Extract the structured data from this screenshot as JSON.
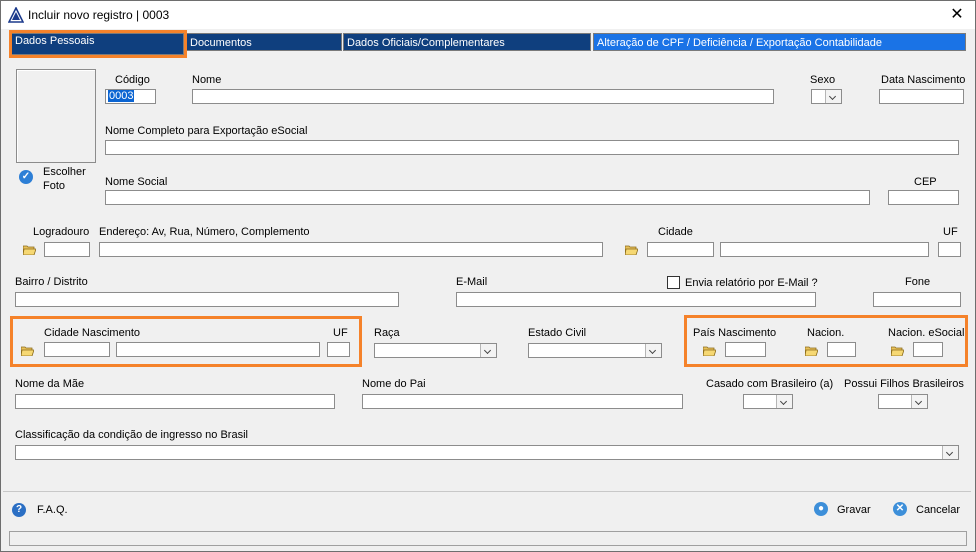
{
  "window": {
    "title": "Incluir novo registro | 0003",
    "close_icon": "close-icon"
  },
  "tabs": [
    {
      "label": "Dados Pessoais"
    },
    {
      "label": "Documentos"
    },
    {
      "label": "Dados Oficiais/Complementares"
    },
    {
      "label": "Alteração de CPF / Deficiência / Exportação Contabilidade"
    }
  ],
  "photo": {
    "choose_label_1": "Escolher",
    "choose_label_2": "Foto"
  },
  "fields": {
    "codigo": {
      "label": "Código",
      "value": "0003"
    },
    "nome": {
      "label": "Nome",
      "value": ""
    },
    "sexo": {
      "label": "Sexo",
      "value": ""
    },
    "data_nascimento": {
      "label": "Data Nascimento",
      "value": ""
    },
    "nome_completo": {
      "label": "Nome Completo para Exportação eSocial",
      "value": ""
    },
    "nome_social": {
      "label": "Nome Social",
      "value": ""
    },
    "cep": {
      "label": "CEP",
      "value": ""
    },
    "logradouro": {
      "label": "Logradouro",
      "value": ""
    },
    "endereco": {
      "label": "Endereço: Av, Rua, Número, Complemento",
      "value": ""
    },
    "cidade": {
      "label": "Cidade",
      "value": ""
    },
    "uf": {
      "label": "UF",
      "value": ""
    },
    "bairro": {
      "label": "Bairro / Distrito",
      "value": ""
    },
    "email": {
      "label": "E-Mail",
      "value": ""
    },
    "envia_relatorio": {
      "label": "Envia relatório por E-Mail ?",
      "checked": false
    },
    "fone": {
      "label": "Fone",
      "value": ""
    },
    "cidade_nascimento": {
      "label": "Cidade Nascimento",
      "value": ""
    },
    "uf_nascimento": {
      "label": "UF",
      "value": ""
    },
    "raca": {
      "label": "Raça",
      "value": ""
    },
    "estado_civil": {
      "label": "Estado Civil",
      "value": ""
    },
    "pais_nascimento": {
      "label": "País Nascimento",
      "value": ""
    },
    "nacion": {
      "label": "Nacion.",
      "value": ""
    },
    "nacion_esocial": {
      "label": "Nacion. eSocial",
      "value": ""
    },
    "nome_mae": {
      "label": "Nome da Mãe",
      "value": ""
    },
    "nome_pai": {
      "label": "Nome do Pai",
      "value": ""
    },
    "casado_brasileiro": {
      "label": "Casado com Brasileiro (a)",
      "value": ""
    },
    "filhos_brasileiros": {
      "label": "Possui Filhos Brasileiros",
      "value": ""
    },
    "classificacao": {
      "label": "Classificação da condição de ingresso no Brasil",
      "value": ""
    }
  },
  "footer": {
    "faq": "F.A.Q.",
    "save": "Gravar",
    "cancel": "Cancelar"
  },
  "colors": {
    "tab_dark": "#0f3f7e",
    "tab_light": "#1a73e6",
    "highlight": "#f5822a"
  }
}
